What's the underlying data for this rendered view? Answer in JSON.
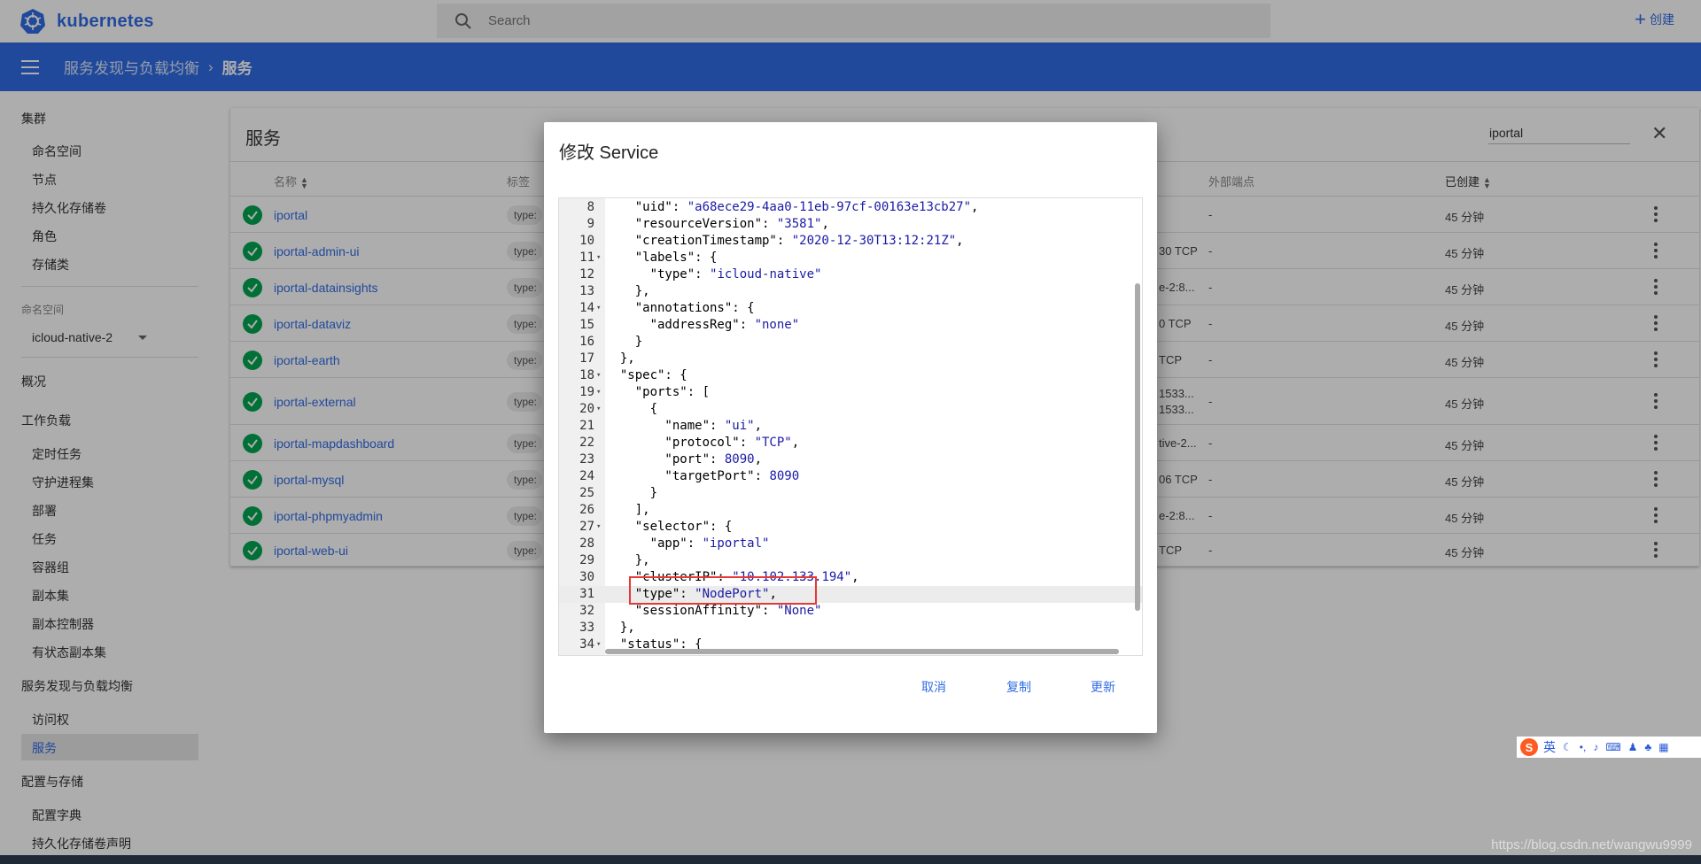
{
  "app": {
    "name": "kubernetes"
  },
  "search": {
    "placeholder": "Search"
  },
  "create_label": "创建",
  "breadcrumb": {
    "parent": "服务发现与负载均衡",
    "current": "服务"
  },
  "sidebar": {
    "cluster_header": "集群",
    "cluster_items": [
      "命名空间",
      "节点",
      "持久化存储卷",
      "角色",
      "存储类"
    ],
    "namespace_label": "命名空间",
    "namespace_value": "icloud-native-2",
    "overview": "概况",
    "workloads_header": "工作负载",
    "workload_items": [
      "定时任务",
      "守护进程集",
      "部署",
      "任务",
      "容器组",
      "副本集",
      "副本控制器",
      "有状态副本集"
    ],
    "discovery_header": "服务发现与负载均衡",
    "discovery_items": [
      "访问权",
      "服务"
    ],
    "config_header": "配置与存储",
    "config_items": [
      "配置字典",
      "持久化存储卷声明"
    ]
  },
  "card": {
    "title": "服务",
    "filter_value": "iportal",
    "columns": {
      "name": "名称",
      "labels": "标签",
      "external": "外部端点",
      "created": "已创建"
    },
    "rows": [
      {
        "name": "iportal",
        "label": "type:",
        "partial": "",
        "external": "-",
        "created": "45 分钟"
      },
      {
        "name": "iportal-admin-ui",
        "label": "type:",
        "partial": "30 TCP",
        "external": "-",
        "created": "45 分钟"
      },
      {
        "name": "iportal-datainsights",
        "label": "type:",
        "partial": "e-2:8...",
        "external": "-",
        "created": "45 分钟"
      },
      {
        "name": "iportal-dataviz",
        "label": "type:",
        "partial": "0 TCP",
        "external": "-",
        "created": "45 分钟"
      },
      {
        "name": "iportal-earth",
        "label": "type:",
        "partial": "TCP",
        "external": "-",
        "created": "45 分钟"
      },
      {
        "name": "iportal-external",
        "label": "type:",
        "partial": "1533...",
        "partial2": "1533...",
        "external": "-",
        "created": "45 分钟"
      },
      {
        "name": "iportal-mapdashboard",
        "label": "type:",
        "partial": "tive-2...",
        "external": "-",
        "created": "45 分钟"
      },
      {
        "name": "iportal-mysql",
        "label": "type:",
        "partial": "06 TCP",
        "external": "-",
        "created": "45 分钟"
      },
      {
        "name": "iportal-phpmyadmin",
        "label": "type:",
        "partial": "e-2:8...",
        "external": "-",
        "created": "45 分钟"
      },
      {
        "name": "iportal-web-ui",
        "label": "type:",
        "partial": "TCP",
        "external": "-",
        "created": "45 分钟"
      }
    ]
  },
  "dialog": {
    "title": "修改 Service",
    "lines": [
      {
        "n": "8",
        "fold": false,
        "text": "    \"uid\": \"a68ece29-4aa0-11eb-97cf-00163e13cb27\","
      },
      {
        "n": "9",
        "fold": false,
        "text": "    \"resourceVersion\": \"3581\","
      },
      {
        "n": "10",
        "fold": false,
        "text": "    \"creationTimestamp\": \"2020-12-30T13:12:21Z\","
      },
      {
        "n": "11",
        "fold": true,
        "text": "    \"labels\": {"
      },
      {
        "n": "12",
        "fold": false,
        "text": "      \"type\": \"icloud-native\""
      },
      {
        "n": "13",
        "fold": false,
        "text": "    },"
      },
      {
        "n": "14",
        "fold": true,
        "text": "    \"annotations\": {"
      },
      {
        "n": "15",
        "fold": false,
        "text": "      \"addressReg\": \"none\""
      },
      {
        "n": "16",
        "fold": false,
        "text": "    }"
      },
      {
        "n": "17",
        "fold": false,
        "text": "  },"
      },
      {
        "n": "18",
        "fold": true,
        "text": "  \"spec\": {"
      },
      {
        "n": "19",
        "fold": true,
        "text": "    \"ports\": ["
      },
      {
        "n": "20",
        "fold": true,
        "text": "      {"
      },
      {
        "n": "21",
        "fold": false,
        "text": "        \"name\": \"ui\","
      },
      {
        "n": "22",
        "fold": false,
        "text": "        \"protocol\": \"TCP\","
      },
      {
        "n": "23",
        "fold": false,
        "text": "        \"port\": 8090,"
      },
      {
        "n": "24",
        "fold": false,
        "text": "        \"targetPort\": 8090"
      },
      {
        "n": "25",
        "fold": false,
        "text": "      }"
      },
      {
        "n": "26",
        "fold": false,
        "text": "    ],"
      },
      {
        "n": "27",
        "fold": true,
        "text": "    \"selector\": {"
      },
      {
        "n": "28",
        "fold": false,
        "text": "      \"app\": \"iportal\""
      },
      {
        "n": "29",
        "fold": false,
        "text": "    },"
      },
      {
        "n": "30",
        "fold": false,
        "text": "    \"clusterIP\": \"10.102.133.194\","
      },
      {
        "n": "31",
        "fold": false,
        "text": "    \"type\": \"NodePort\","
      },
      {
        "n": "32",
        "fold": false,
        "text": "    \"sessionAffinity\": \"None\""
      },
      {
        "n": "33",
        "fold": false,
        "text": "  },"
      },
      {
        "n": "34",
        "fold": true,
        "text": "  \"status\": {"
      }
    ],
    "active_line": "31",
    "cancel": "取消",
    "copy": "复制",
    "update": "更新"
  },
  "ime": {
    "mode": "英"
  },
  "watermark": "https://blog.csdn.net/wangwu9999",
  "colors": {
    "brand": "#326ce5",
    "success": "#00a651",
    "highlight": "#e53935"
  }
}
